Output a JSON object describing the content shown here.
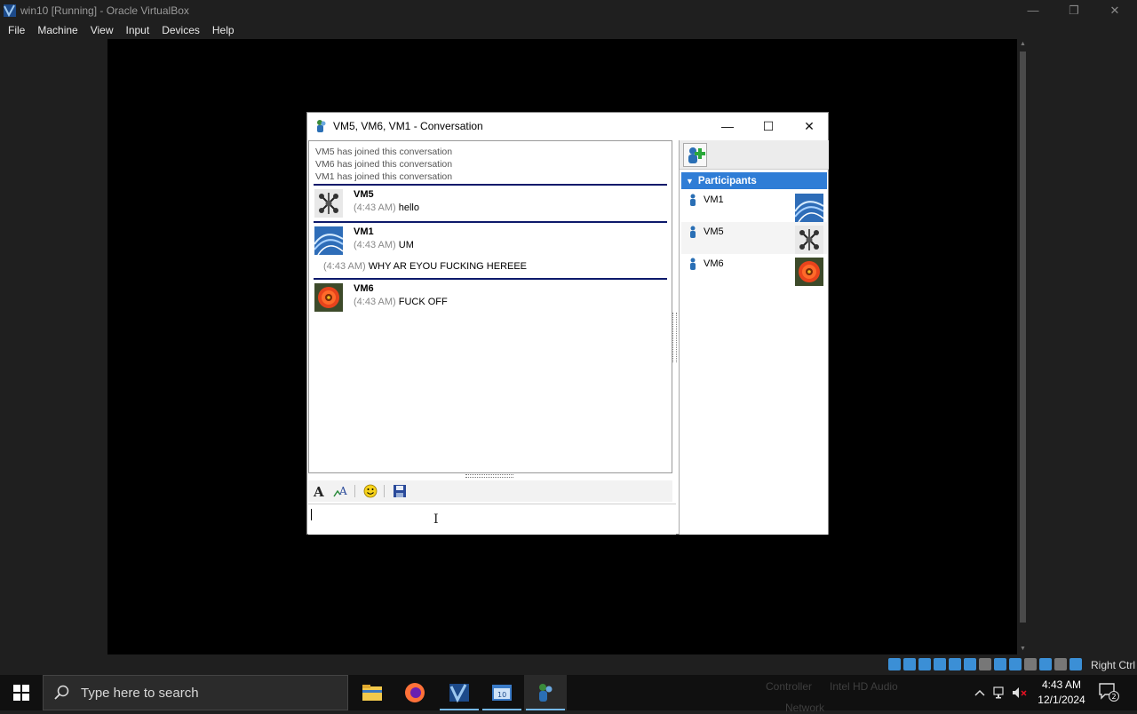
{
  "host": {
    "title": "win10 [Running] - Oracle VirtualBox",
    "menu": [
      "File",
      "Machine",
      "View",
      "Input",
      "Devices",
      "Help"
    ],
    "host_key": "Right Ctrl"
  },
  "conversation": {
    "title": "VM5, VM6, VM1 - Conversation",
    "system_lines": [
      "VM5 has joined this conversation",
      "VM6 has joined this conversation",
      "VM1 has joined this conversation"
    ],
    "messages": [
      {
        "sender": "VM5",
        "time": "(4:43 AM)",
        "text": "hello",
        "avatar": "network-avatar"
      },
      {
        "sender": "VM1",
        "time": "(4:43 AM)",
        "text": "UM",
        "avatar": "blue-lines-avatar",
        "continuation": {
          "time": "(4:43 AM)",
          "text": "WHY AR EYOU FUCKING HEREEE"
        }
      },
      {
        "sender": "VM6",
        "time": "(4:43 AM)",
        "text": "FUCK OFF",
        "avatar": "flower-avatar"
      }
    ],
    "input_value": "",
    "participants_header": "Participants",
    "participants": [
      {
        "name": "VM1",
        "avatar": "blue-lines-avatar"
      },
      {
        "name": "VM5",
        "avatar": "network-avatar"
      },
      {
        "name": "VM6",
        "avatar": "flower-avatar"
      }
    ]
  },
  "taskbar": {
    "search_placeholder": "Type here to search",
    "time": "4:43 AM",
    "date": "12/1/2024",
    "notification_count": "2",
    "ghost_labels": [
      "Controller",
      "Intel HD Audio",
      "Network"
    ]
  },
  "colors": {
    "participants_header": "#2f7dd6",
    "message_divider": "#0d1a6b",
    "taskbar_active": "#76b9ed"
  }
}
